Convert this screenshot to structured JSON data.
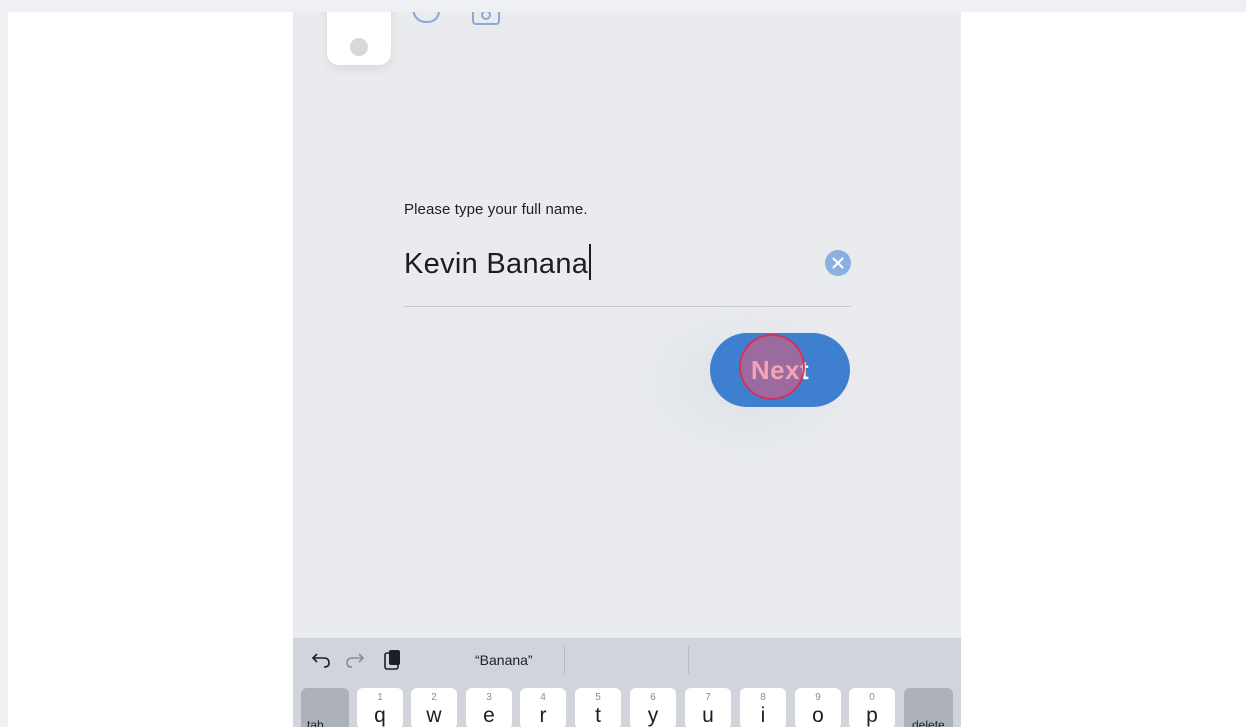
{
  "form": {
    "prompt": "Please type your full name.",
    "name_value": "Kevin Banana",
    "next_label": "Next"
  },
  "keyboard": {
    "suggestion": "“Banana”",
    "tab_label": "tab",
    "delete_label": "delete",
    "keys": [
      {
        "num": "1",
        "ch": "q"
      },
      {
        "num": "2",
        "ch": "w"
      },
      {
        "num": "3",
        "ch": "e"
      },
      {
        "num": "4",
        "ch": "r"
      },
      {
        "num": "5",
        "ch": "t"
      },
      {
        "num": "6",
        "ch": "y"
      },
      {
        "num": "7",
        "ch": "u"
      },
      {
        "num": "8",
        "ch": "i"
      },
      {
        "num": "9",
        "ch": "o"
      },
      {
        "num": "0",
        "ch": "p"
      }
    ]
  },
  "icons": {
    "pen": "pen-icon",
    "comment": "comment-icon",
    "camera": "camera-icon",
    "close": "close-icon",
    "clear": "clear-icon",
    "undo": "undo-icon",
    "redo": "redo-icon",
    "paste": "paste-icon"
  },
  "colors": {
    "accent": "#3f7fcf",
    "clear_button": "#8ab0e0",
    "tap_marker": "#e85a78"
  }
}
